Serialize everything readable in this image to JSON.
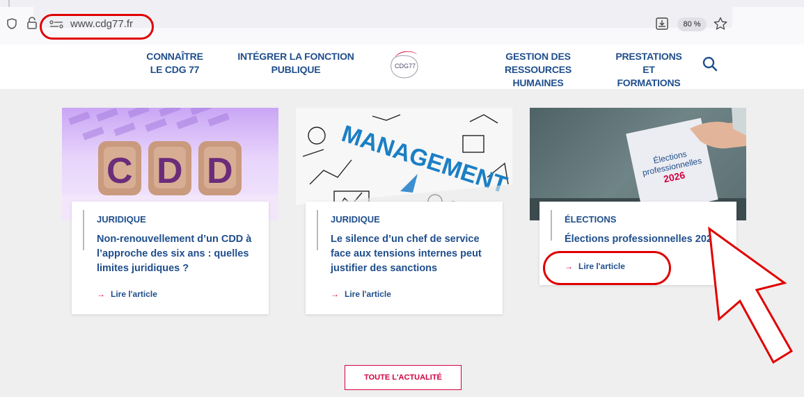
{
  "browser": {
    "url": "www.cdg77.fr",
    "zoom": "80 %",
    "icons": [
      "shield-icon",
      "lock-icon",
      "site-info-icon",
      "download-icon",
      "star-icon"
    ]
  },
  "nav": {
    "items": [
      {
        "line1": "CONNAÎTRE",
        "line2": "LE CDG 77"
      },
      {
        "line1": "INTÉGRER LA FONCTION",
        "line2": "PUBLIQUE"
      },
      {
        "line1": "GESTION DES RESSOURCES",
        "line2": "HUMAINES"
      },
      {
        "line1": "PRESTATIONS ET",
        "line2": "FORMATIONS"
      }
    ],
    "logo_text": "CDG77"
  },
  "articles": [
    {
      "category": "JURIDIQUE",
      "title": "Non-renouvellement d’un CDD à l’approche des six ans  : quelles limites juridiques ?",
      "link": "Lire l'article",
      "image_text": "CDD"
    },
    {
      "category": "JURIDIQUE",
      "title": "Le silence d’un chef de service face aux tensions internes peut justifier des sanctions",
      "link": "Lire l'article",
      "image_text": "MANAGEMENT"
    },
    {
      "category": "ÉLECTIONS",
      "title": "Élections professionnelles 2026",
      "link": "Lire l'article",
      "image_text": {
        "line1": "Élections",
        "line2": "professionnelles",
        "line3": "2026"
      }
    }
  ],
  "footer": {
    "all_news": "TOUTE L'ACTUALITÉ"
  },
  "colors": {
    "brand_blue": "#1f4e8c",
    "accent_red": "#d3003f",
    "annotation_red": "#e00000"
  }
}
